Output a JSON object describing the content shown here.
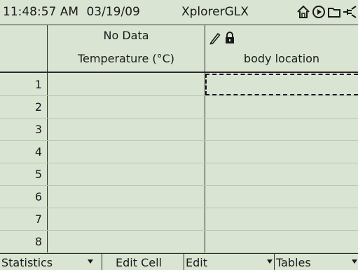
{
  "status": {
    "time": "11:48:57 AM",
    "date": "03/19/09",
    "app_name": "XplorerGLX",
    "icons": [
      "home-icon",
      "play-icon",
      "folder-icon",
      "power-icon"
    ]
  },
  "table": {
    "columns": [
      {
        "line1": "No Data",
        "line2": "Temperature (°C)"
      },
      {
        "line1": "",
        "line2": "body location",
        "icons": [
          "pencil-icon",
          "lock-icon"
        ]
      }
    ],
    "rows": [
      "1",
      "2",
      "3",
      "4",
      "5",
      "6",
      "7",
      "8"
    ]
  },
  "softkeys": [
    {
      "label": "Statistics",
      "dropdown": true
    },
    {
      "label": "Edit Cell",
      "dropdown": false
    },
    {
      "label": "Edit",
      "dropdown": true
    },
    {
      "label": "Tables",
      "dropdown": true
    }
  ],
  "colors": {
    "screen_bg": "#d9e5d2",
    "row_rule": "#b7c9b0",
    "text": "#1a1a1a"
  }
}
